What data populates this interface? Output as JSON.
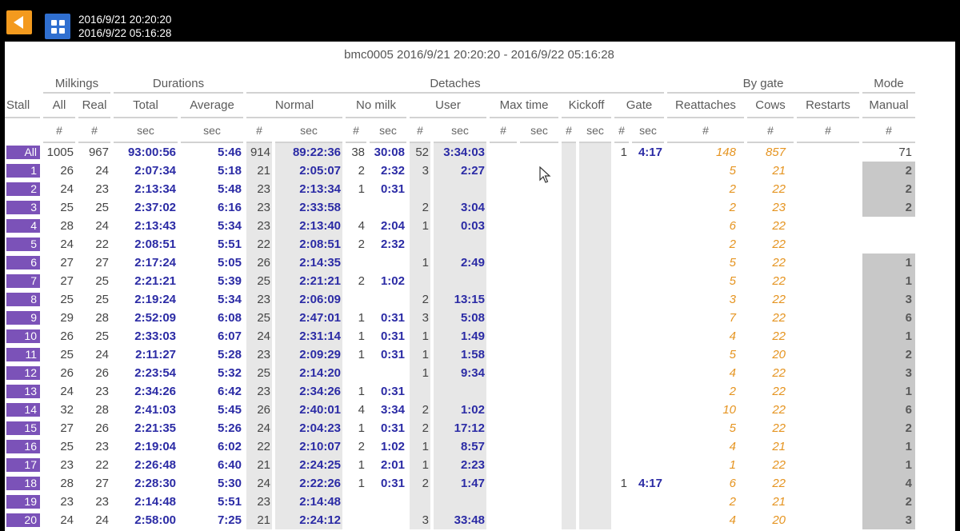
{
  "header": {
    "range_start": "2016/9/21 20:20:20",
    "range_end": "2016/9/22 05:16:28"
  },
  "report": {
    "title": "bmc0005 2016/9/21 20:20:20 - 2016/9/22 05:16:28",
    "groups": {
      "milkings": "Milkings",
      "durations": "Durations",
      "detaches": "Detaches",
      "by_gate": "By gate",
      "mode": "Mode"
    },
    "columns": {
      "stall": "Stall",
      "all": "All",
      "real": "Real",
      "total": "Total",
      "average": "Average",
      "normal": "Normal",
      "no_milk": "No milk",
      "user": "User",
      "max_time": "Max time",
      "kickoff": "Kickoff",
      "gate": "Gate",
      "reattaches": "Reattaches",
      "cows": "Cows",
      "restarts": "Restarts",
      "manual": "Manual"
    },
    "units": {
      "count": "#",
      "sec": "sec"
    },
    "rows": [
      {
        "stall": "All",
        "all": "1005",
        "real": "967",
        "total": "93:00:56",
        "avg": "5:46",
        "normal_n": "914",
        "normal_s": "89:22:36",
        "nomilk_n": "38",
        "nomilk_s": "30:08",
        "user_n": "52",
        "user_s": "3:34:03",
        "gate_n": "1",
        "gate_s": "4:17",
        "reattaches": "148",
        "cows": "857",
        "manual": "71"
      },
      {
        "stall": "1",
        "all": "26",
        "real": "24",
        "total": "2:07:34",
        "avg": "5:18",
        "normal_n": "21",
        "normal_s": "2:05:07",
        "nomilk_n": "2",
        "nomilk_s": "2:32",
        "user_n": "3",
        "user_s": "2:27",
        "gate_n": "",
        "gate_s": "",
        "reattaches": "5",
        "cows": "21",
        "manual": "2"
      },
      {
        "stall": "2",
        "all": "24",
        "real": "23",
        "total": "2:13:34",
        "avg": "5:48",
        "normal_n": "23",
        "normal_s": "2:13:34",
        "nomilk_n": "1",
        "nomilk_s": "0:31",
        "user_n": "",
        "user_s": "",
        "gate_n": "",
        "gate_s": "",
        "reattaches": "2",
        "cows": "22",
        "manual": "2"
      },
      {
        "stall": "3",
        "all": "25",
        "real": "25",
        "total": "2:37:02",
        "avg": "6:16",
        "normal_n": "23",
        "normal_s": "2:33:58",
        "nomilk_n": "",
        "nomilk_s": "",
        "user_n": "2",
        "user_s": "3:04",
        "gate_n": "",
        "gate_s": "",
        "reattaches": "2",
        "cows": "23",
        "manual": "2"
      },
      {
        "stall": "4",
        "all": "28",
        "real": "24",
        "total": "2:13:43",
        "avg": "5:34",
        "normal_n": "23",
        "normal_s": "2:13:40",
        "nomilk_n": "4",
        "nomilk_s": "2:04",
        "user_n": "1",
        "user_s": "0:03",
        "gate_n": "",
        "gate_s": "",
        "reattaches": "6",
        "cows": "22",
        "manual": ""
      },
      {
        "stall": "5",
        "all": "24",
        "real": "22",
        "total": "2:08:51",
        "avg": "5:51",
        "normal_n": "22",
        "normal_s": "2:08:51",
        "nomilk_n": "2",
        "nomilk_s": "2:32",
        "user_n": "",
        "user_s": "",
        "gate_n": "",
        "gate_s": "",
        "reattaches": "2",
        "cows": "22",
        "manual": ""
      },
      {
        "stall": "6",
        "all": "27",
        "real": "27",
        "total": "2:17:24",
        "avg": "5:05",
        "normal_n": "26",
        "normal_s": "2:14:35",
        "nomilk_n": "",
        "nomilk_s": "",
        "user_n": "1",
        "user_s": "2:49",
        "gate_n": "",
        "gate_s": "",
        "reattaches": "5",
        "cows": "22",
        "manual": "1"
      },
      {
        "stall": "7",
        "all": "27",
        "real": "25",
        "total": "2:21:21",
        "avg": "5:39",
        "normal_n": "25",
        "normal_s": "2:21:21",
        "nomilk_n": "2",
        "nomilk_s": "1:02",
        "user_n": "",
        "user_s": "",
        "gate_n": "",
        "gate_s": "",
        "reattaches": "5",
        "cows": "22",
        "manual": "1"
      },
      {
        "stall": "8",
        "all": "25",
        "real": "25",
        "total": "2:19:24",
        "avg": "5:34",
        "normal_n": "23",
        "normal_s": "2:06:09",
        "nomilk_n": "",
        "nomilk_s": "",
        "user_n": "2",
        "user_s": "13:15",
        "gate_n": "",
        "gate_s": "",
        "reattaches": "3",
        "cows": "22",
        "manual": "3"
      },
      {
        "stall": "9",
        "all": "29",
        "real": "28",
        "total": "2:52:09",
        "avg": "6:08",
        "normal_n": "25",
        "normal_s": "2:47:01",
        "nomilk_n": "1",
        "nomilk_s": "0:31",
        "user_n": "3",
        "user_s": "5:08",
        "gate_n": "",
        "gate_s": "",
        "reattaches": "7",
        "cows": "22",
        "manual": "6"
      },
      {
        "stall": "10",
        "all": "26",
        "real": "25",
        "total": "2:33:03",
        "avg": "6:07",
        "normal_n": "24",
        "normal_s": "2:31:14",
        "nomilk_n": "1",
        "nomilk_s": "0:31",
        "user_n": "1",
        "user_s": "1:49",
        "gate_n": "",
        "gate_s": "",
        "reattaches": "4",
        "cows": "22",
        "manual": "1"
      },
      {
        "stall": "11",
        "all": "25",
        "real": "24",
        "total": "2:11:27",
        "avg": "5:28",
        "normal_n": "23",
        "normal_s": "2:09:29",
        "nomilk_n": "1",
        "nomilk_s": "0:31",
        "user_n": "1",
        "user_s": "1:58",
        "gate_n": "",
        "gate_s": "",
        "reattaches": "5",
        "cows": "20",
        "manual": "2"
      },
      {
        "stall": "12",
        "all": "26",
        "real": "26",
        "total": "2:23:54",
        "avg": "5:32",
        "normal_n": "25",
        "normal_s": "2:14:20",
        "nomilk_n": "",
        "nomilk_s": "",
        "user_n": "1",
        "user_s": "9:34",
        "gate_n": "",
        "gate_s": "",
        "reattaches": "4",
        "cows": "22",
        "manual": "3"
      },
      {
        "stall": "13",
        "all": "24",
        "real": "23",
        "total": "2:34:26",
        "avg": "6:42",
        "normal_n": "23",
        "normal_s": "2:34:26",
        "nomilk_n": "1",
        "nomilk_s": "0:31",
        "user_n": "",
        "user_s": "",
        "gate_n": "",
        "gate_s": "",
        "reattaches": "2",
        "cows": "22",
        "manual": "1"
      },
      {
        "stall": "14",
        "all": "32",
        "real": "28",
        "total": "2:41:03",
        "avg": "5:45",
        "normal_n": "26",
        "normal_s": "2:40:01",
        "nomilk_n": "4",
        "nomilk_s": "3:34",
        "user_n": "2",
        "user_s": "1:02",
        "gate_n": "",
        "gate_s": "",
        "reattaches": "10",
        "cows": "22",
        "manual": "6"
      },
      {
        "stall": "15",
        "all": "27",
        "real": "26",
        "total": "2:21:35",
        "avg": "5:26",
        "normal_n": "24",
        "normal_s": "2:04:23",
        "nomilk_n": "1",
        "nomilk_s": "0:31",
        "user_n": "2",
        "user_s": "17:12",
        "gate_n": "",
        "gate_s": "",
        "reattaches": "5",
        "cows": "22",
        "manual": "2"
      },
      {
        "stall": "16",
        "all": "25",
        "real": "23",
        "total": "2:19:04",
        "avg": "6:02",
        "normal_n": "22",
        "normal_s": "2:10:07",
        "nomilk_n": "2",
        "nomilk_s": "1:02",
        "user_n": "1",
        "user_s": "8:57",
        "gate_n": "",
        "gate_s": "",
        "reattaches": "4",
        "cows": "21",
        "manual": "1"
      },
      {
        "stall": "17",
        "all": "23",
        "real": "22",
        "total": "2:26:48",
        "avg": "6:40",
        "normal_n": "21",
        "normal_s": "2:24:25",
        "nomilk_n": "1",
        "nomilk_s": "2:01",
        "user_n": "1",
        "user_s": "2:23",
        "gate_n": "",
        "gate_s": "",
        "reattaches": "1",
        "cows": "22",
        "manual": "1"
      },
      {
        "stall": "18",
        "all": "28",
        "real": "27",
        "total": "2:28:30",
        "avg": "5:30",
        "normal_n": "24",
        "normal_s": "2:22:26",
        "nomilk_n": "1",
        "nomilk_s": "0:31",
        "user_n": "2",
        "user_s": "1:47",
        "gate_n": "1",
        "gate_s": "4:17",
        "reattaches": "6",
        "cows": "22",
        "manual": "4"
      },
      {
        "stall": "19",
        "all": "23",
        "real": "23",
        "total": "2:14:48",
        "avg": "5:51",
        "normal_n": "23",
        "normal_s": "2:14:48",
        "nomilk_n": "",
        "nomilk_s": "",
        "user_n": "",
        "user_s": "",
        "gate_n": "",
        "gate_s": "",
        "reattaches": "2",
        "cows": "21",
        "manual": "2"
      },
      {
        "stall": "20",
        "all": "24",
        "real": "24",
        "total": "2:58:00",
        "avg": "7:25",
        "normal_n": "21",
        "normal_s": "2:24:12",
        "nomilk_n": "",
        "nomilk_s": "",
        "user_n": "3",
        "user_s": "33:48",
        "gate_n": "",
        "gate_s": "",
        "reattaches": "4",
        "cows": "20",
        "manual": "3"
      }
    ]
  }
}
